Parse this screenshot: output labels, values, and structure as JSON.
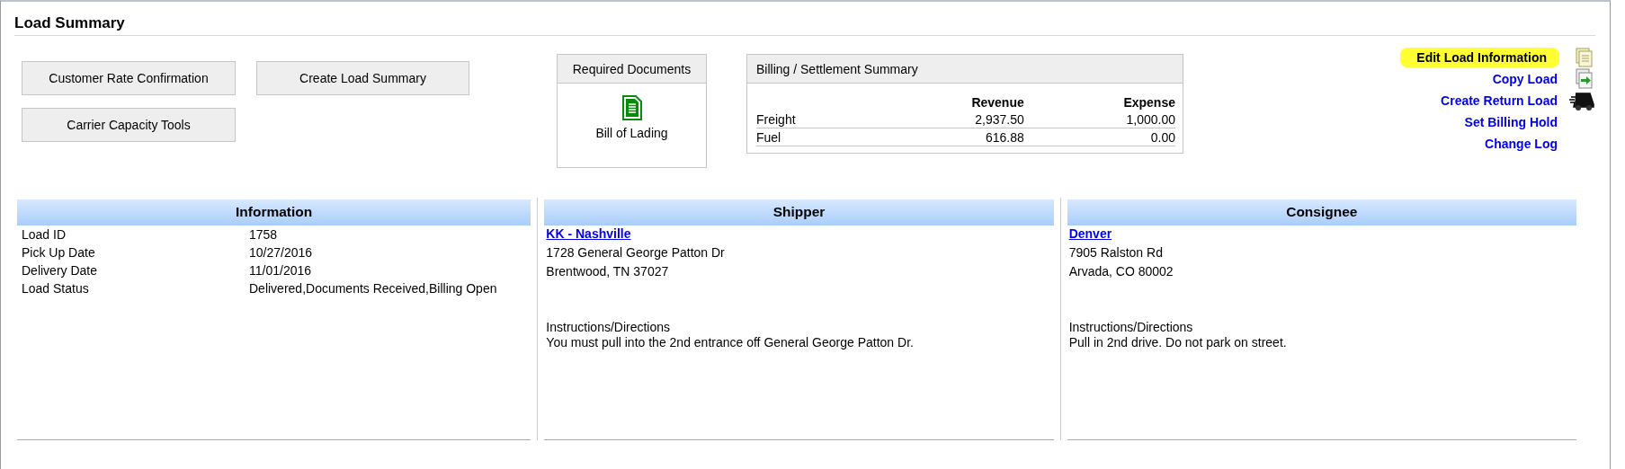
{
  "title": "Load Summary",
  "buttons": [
    {
      "label": "Customer Rate Confirmation"
    },
    {
      "label": "Create Load Summary"
    },
    {
      "label": "Carrier Capacity Tools"
    }
  ],
  "required_documents": {
    "title": "Required Documents",
    "items": [
      {
        "label": "Bill of Lading"
      }
    ]
  },
  "billing": {
    "title": "Billing / Settlement Summary",
    "columns": [
      "Revenue",
      "Expense"
    ],
    "rows": [
      {
        "label": "Freight",
        "revenue": "2,937.50",
        "expense": "1,000.00"
      },
      {
        "label": "Fuel",
        "revenue": "616.88",
        "expense": "0.00"
      }
    ]
  },
  "actions": [
    {
      "label": "Edit Load Information",
      "kind": "pages",
      "highlighted": true
    },
    {
      "label": "Copy Load",
      "kind": "copy",
      "highlighted": false
    },
    {
      "label": "Create Return Load",
      "kind": "truck",
      "highlighted": false
    },
    {
      "label": "Set Billing Hold",
      "kind": "plain",
      "highlighted": false
    },
    {
      "label": "Change Log",
      "kind": "plain",
      "highlighted": false
    }
  ],
  "information": {
    "title": "Information",
    "rows": [
      {
        "label": "Load ID",
        "value": "1758"
      },
      {
        "label": "Pick Up Date",
        "value": "10/27/2016"
      },
      {
        "label": "Delivery Date",
        "value": "11/01/2016"
      },
      {
        "label": "Load Status",
        "value": "Delivered,Documents Received,Billing Open"
      }
    ]
  },
  "shipper": {
    "title": "Shipper",
    "name": "KK - Nashville",
    "address": [
      "1728 General George Patton Dr",
      "Brentwood, TN 37027"
    ],
    "instructions_label": "Instructions/Directions",
    "instructions": "You must pull into the 2nd entrance off General George Patton Dr."
  },
  "consignee": {
    "title": "Consignee",
    "name": "Denver",
    "address": [
      "7905 Ralston Rd",
      "Arvada, CO 80002"
    ],
    "instructions_label": "Instructions/Directions",
    "instructions": "Pull in 2nd drive. Do not park on street."
  }
}
